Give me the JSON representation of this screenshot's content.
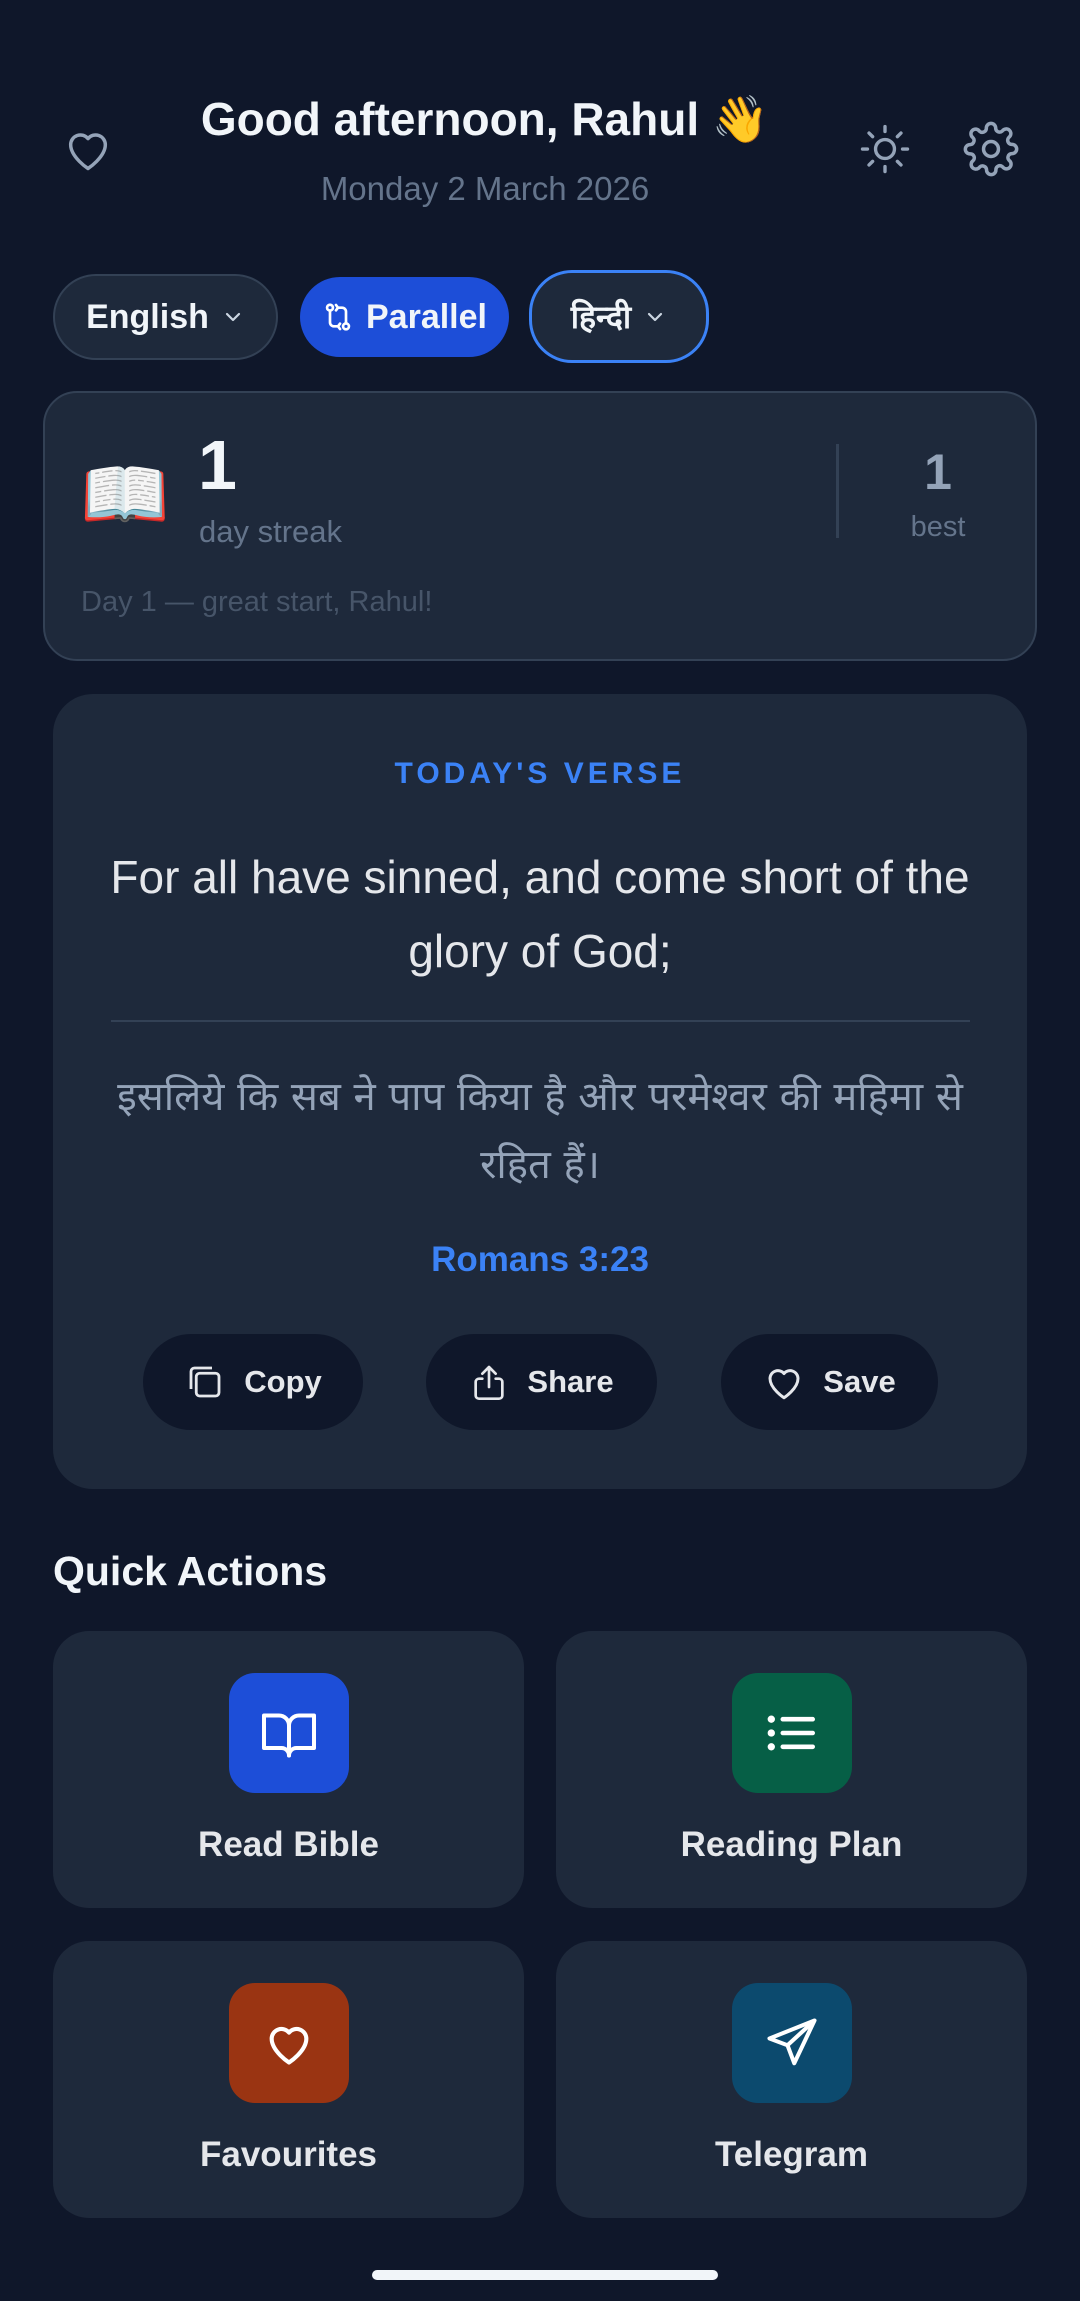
{
  "header": {
    "greeting": "Good afternoon, Rahul 👋",
    "date": "Monday 2 March 2026",
    "icons": [
      "heart-icon",
      "sun-icon",
      "gear-icon"
    ]
  },
  "languages": {
    "primary": "English",
    "mode": "Parallel",
    "secondary": "हिन्दी"
  },
  "streak": {
    "emoji": "📖",
    "count": "1",
    "label": "day streak",
    "best_count": "1",
    "best_label": "best",
    "message": "Day 1 — great start, Rahul!"
  },
  "verse": {
    "kicker": "TODAY'S VERSE",
    "english": "For all have sinned, and come short of the glory of God;",
    "hindi": "इसलिये कि सब ने पाप किया है और परमेश्वर की महिमा से रहित हैं।",
    "reference": "Romans 3:23",
    "actions": {
      "copy": "Copy",
      "share": "Share",
      "save": "Save"
    }
  },
  "quick_actions": {
    "title": "Quick Actions",
    "items": [
      {
        "label": "Read Bible",
        "icon": "book-icon",
        "color": "#1d4ed8"
      },
      {
        "label": "Reading Plan",
        "icon": "list-icon",
        "color": "#065f46"
      },
      {
        "label": "Favourites",
        "icon": "heart-icon",
        "color": "#9a3412"
      },
      {
        "label": "Telegram",
        "icon": "send-icon",
        "color": "#0c4a6e"
      }
    ]
  },
  "colors": {
    "background": "#0f172a",
    "card": "#1e293b",
    "accent": "#3b82f6",
    "primary_button": "#1d4ed8"
  }
}
